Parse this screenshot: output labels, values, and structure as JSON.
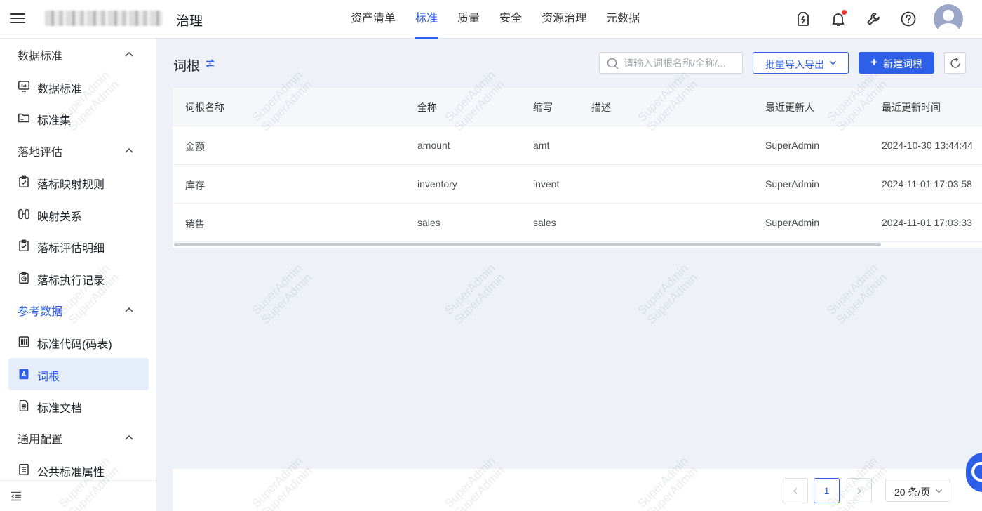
{
  "header": {
    "app_title": "治理",
    "nav": [
      {
        "label": "资产清单",
        "active": false
      },
      {
        "label": "标准",
        "active": true
      },
      {
        "label": "质量",
        "active": false
      },
      {
        "label": "安全",
        "active": false
      },
      {
        "label": "资源治理",
        "active": false
      },
      {
        "label": "元数据",
        "active": false
      }
    ],
    "icons": [
      "battery-charge-icon",
      "bell-icon",
      "wrench-icon",
      "help-icon",
      "avatar"
    ],
    "notification_dot": true
  },
  "sidebar": {
    "groups": [
      {
        "label": "数据标准",
        "expanded": true,
        "active": false,
        "items": [
          {
            "label": "数据标准",
            "icon": "monitor-icon",
            "active": false
          },
          {
            "label": "标准集",
            "icon": "folder-icon",
            "active": false
          }
        ]
      },
      {
        "label": "落地评估",
        "expanded": true,
        "active": false,
        "items": [
          {
            "label": "落标映射规则",
            "icon": "clipboard-check-icon",
            "active": false
          },
          {
            "label": "映射关系",
            "icon": "mapping-icon",
            "active": false
          },
          {
            "label": "落标评估明细",
            "icon": "clipboard-check-icon",
            "active": false
          },
          {
            "label": "落标执行记录",
            "icon": "clipboard-clock-icon",
            "active": false
          }
        ]
      },
      {
        "label": "参考数据",
        "expanded": true,
        "active": true,
        "items": [
          {
            "label": "标准代码(码表)",
            "icon": "barcode-icon",
            "active": false
          },
          {
            "label": "词根",
            "icon": "letter-a-icon",
            "active": true
          },
          {
            "label": "标准文档",
            "icon": "document-icon",
            "active": false
          }
        ]
      },
      {
        "label": "通用配置",
        "expanded": true,
        "active": false,
        "items": [
          {
            "label": "公共标准属性",
            "icon": "list-icon",
            "active": false
          }
        ]
      }
    ]
  },
  "main": {
    "title": "词根",
    "search": {
      "placeholder": "请输入词根名称/全称/...",
      "value": ""
    },
    "import_export_label": "批量导入导出",
    "new_button_label": "新建词根",
    "table": {
      "columns": [
        "词根名称",
        "全称",
        "缩写",
        "描述",
        "最近更新人",
        "最近更新时间"
      ],
      "rows": [
        [
          "金额",
          "amount",
          "amt",
          "",
          "SuperAdmin",
          "2024-10-30 13:44:44"
        ],
        [
          "库存",
          "inventory",
          "invent",
          "",
          "SuperAdmin",
          "2024-11-01 17:03:58"
        ],
        [
          "销售",
          "sales",
          "sales",
          "",
          "SuperAdmin",
          "2024-11-01 17:03:33"
        ]
      ]
    },
    "pagination": {
      "current_page": "1",
      "page_size_label": "20 条/页"
    }
  },
  "watermark": {
    "lines": [
      "SuperAdmin",
      "SuperAdmin"
    ]
  },
  "colors": {
    "accent": "#2d5fe8",
    "page_bg": "#eef1f7",
    "active_menu_bg": "#e6edfb",
    "notification": "#f0352d"
  }
}
